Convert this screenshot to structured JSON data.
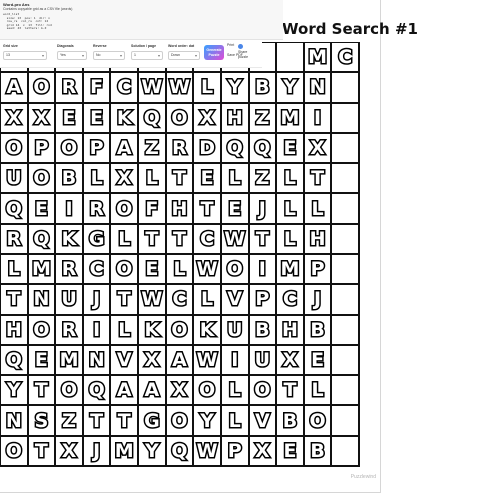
{
  "puzzle": {
    "title": "Word Search #1",
    "grid": [
      [
        "",
        "",
        "",
        "",
        "",
        "",
        "",
        "",
        "",
        "",
        "",
        "M",
        "C"
      ],
      [
        "A",
        "O",
        "R",
        "F",
        "C",
        "W",
        "W",
        "L",
        "Y",
        "B",
        "Y",
        "N",
        ""
      ],
      [
        "X",
        "X",
        "E",
        "E",
        "K",
        "Q",
        "O",
        "X",
        "H",
        "Z",
        "M",
        "I",
        ""
      ],
      [
        "O",
        "P",
        "O",
        "P",
        "A",
        "Z",
        "R",
        "D",
        "Q",
        "Q",
        "E",
        "X",
        ""
      ],
      [
        "U",
        "O",
        "B",
        "L",
        "X",
        "L",
        "T",
        "E",
        "L",
        "Z",
        "L",
        "T",
        ""
      ],
      [
        "Q",
        "E",
        "I",
        "R",
        "O",
        "F",
        "H",
        "T",
        "E",
        "J",
        "L",
        "L",
        ""
      ],
      [
        "R",
        "Q",
        "K",
        "G",
        "L",
        "T",
        "T",
        "C",
        "W",
        "T",
        "L",
        "H",
        ""
      ],
      [
        "L",
        "M",
        "R",
        "C",
        "O",
        "E",
        "L",
        "W",
        "O",
        "I",
        "M",
        "P",
        ""
      ],
      [
        "T",
        "N",
        "U",
        "J",
        "T",
        "W",
        "C",
        "L",
        "V",
        "P",
        "C",
        "J",
        ""
      ],
      [
        "H",
        "O",
        "R",
        "I",
        "L",
        "K",
        "O",
        "K",
        "U",
        "B",
        "H",
        "B",
        ""
      ],
      [
        "Q",
        "E",
        "M",
        "N",
        "V",
        "X",
        "A",
        "W",
        "I",
        "U",
        "X",
        "E",
        ""
      ],
      [
        "Y",
        "T",
        "O",
        "Q",
        "A",
        "A",
        "X",
        "O",
        "L",
        "O",
        "T",
        "L",
        ""
      ],
      [
        "N",
        "S",
        "Z",
        "T",
        "T",
        "G",
        "O",
        "Y",
        "L",
        "V",
        "B",
        "O",
        ""
      ],
      [
        "O",
        "T",
        "X",
        "J",
        "M",
        "Y",
        "Q",
        "W",
        "P",
        "X",
        "E",
        "B",
        ""
      ]
    ],
    "footer_brand": "Puzzlewind"
  },
  "code_panel": {
    "title": "Word-pro Ans",
    "description": "Contains copyable grid as a CSV file (words)",
    "lines": [
      "word_list",
      "  size: 13  pos: 1  dir: x",
      "  row_rs  col_rs  cnt: 12",
      "  grid 14  x  13  fill: rnd",
      "  seed: 43  letters: A-Z"
    ]
  },
  "toolbar": {
    "grid_size_label": "Grid size",
    "grid_size_value": "13",
    "diagonals_label": "Diagonals",
    "diagonals_value": "Yes",
    "reverse_label": "Reverse",
    "reverse_value": "No",
    "solution_label": "Solution / page",
    "solution_value": "1",
    "word_list_label": "Word order: dat",
    "word_list_value": "Down",
    "generate_label": "Generate Puzzle",
    "print_label": "Print",
    "save_label": "Save PDF",
    "share_label": "Share puzzle"
  },
  "colors": {
    "cell_border": "#111111",
    "gradient_start": "#35a1ff",
    "gradient_end": "#e04bd6"
  }
}
